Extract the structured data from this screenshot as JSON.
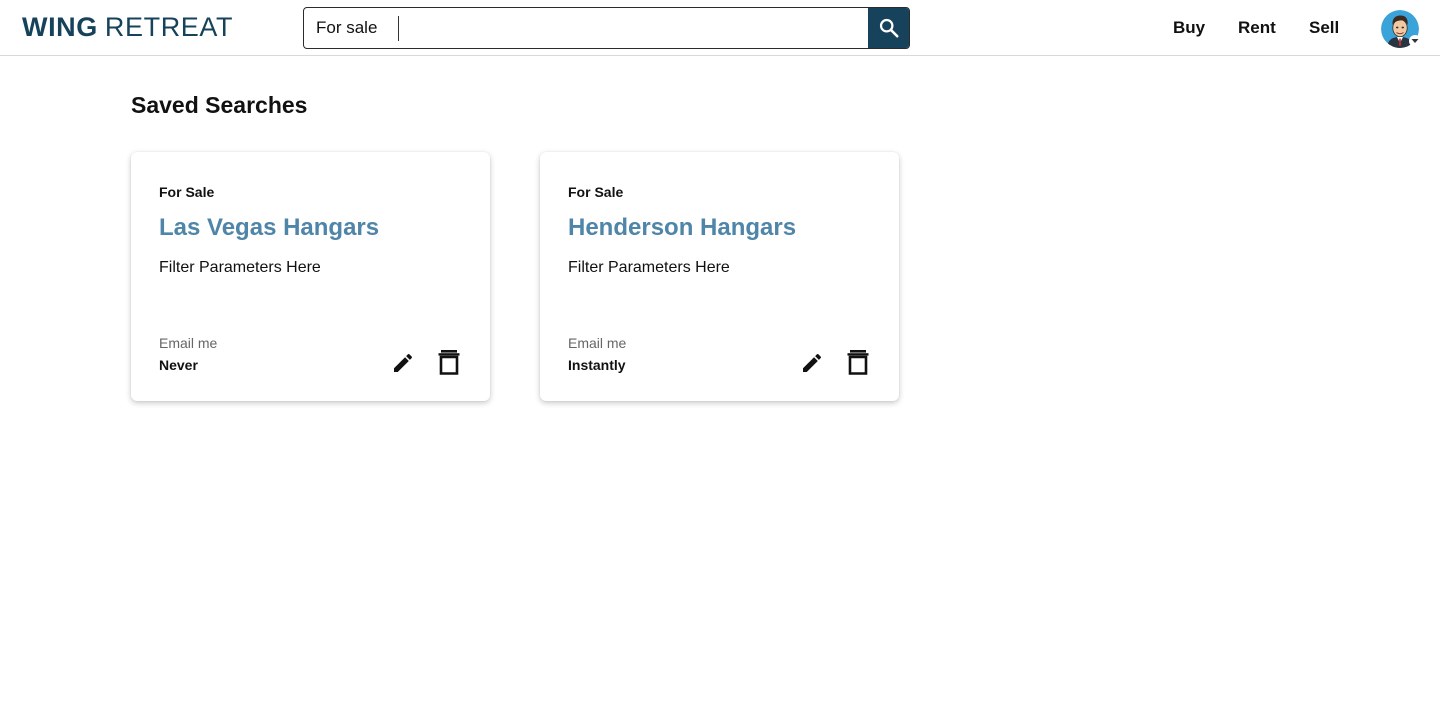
{
  "brand": {
    "name_bold": "WING",
    "name_light": "RETREAT",
    "color": "#16425b"
  },
  "search": {
    "type_selected": "For sale",
    "value": "",
    "placeholder": "",
    "button_icon": "search-icon"
  },
  "nav": {
    "buy": "Buy",
    "rent": "Rent",
    "sell": "Sell"
  },
  "user": {
    "avatar_icon": "user-avatar",
    "caret_icon": "chevron-down-icon"
  },
  "page": {
    "title": "Saved Searches"
  },
  "saved_searches": [
    {
      "type": "For Sale",
      "title": "Las Vegas Hangars",
      "filter": "Filter Parameters Here",
      "email_label": "Email me",
      "email_value": "Never"
    },
    {
      "type": "For Sale",
      "title": "Henderson Hangars",
      "filter": "Filter Parameters Here",
      "email_label": "Email me",
      "email_value": "Instantly"
    }
  ],
  "colors": {
    "accent": "#16425b",
    "card_title": "#4e85a8",
    "muted": "#666666"
  }
}
